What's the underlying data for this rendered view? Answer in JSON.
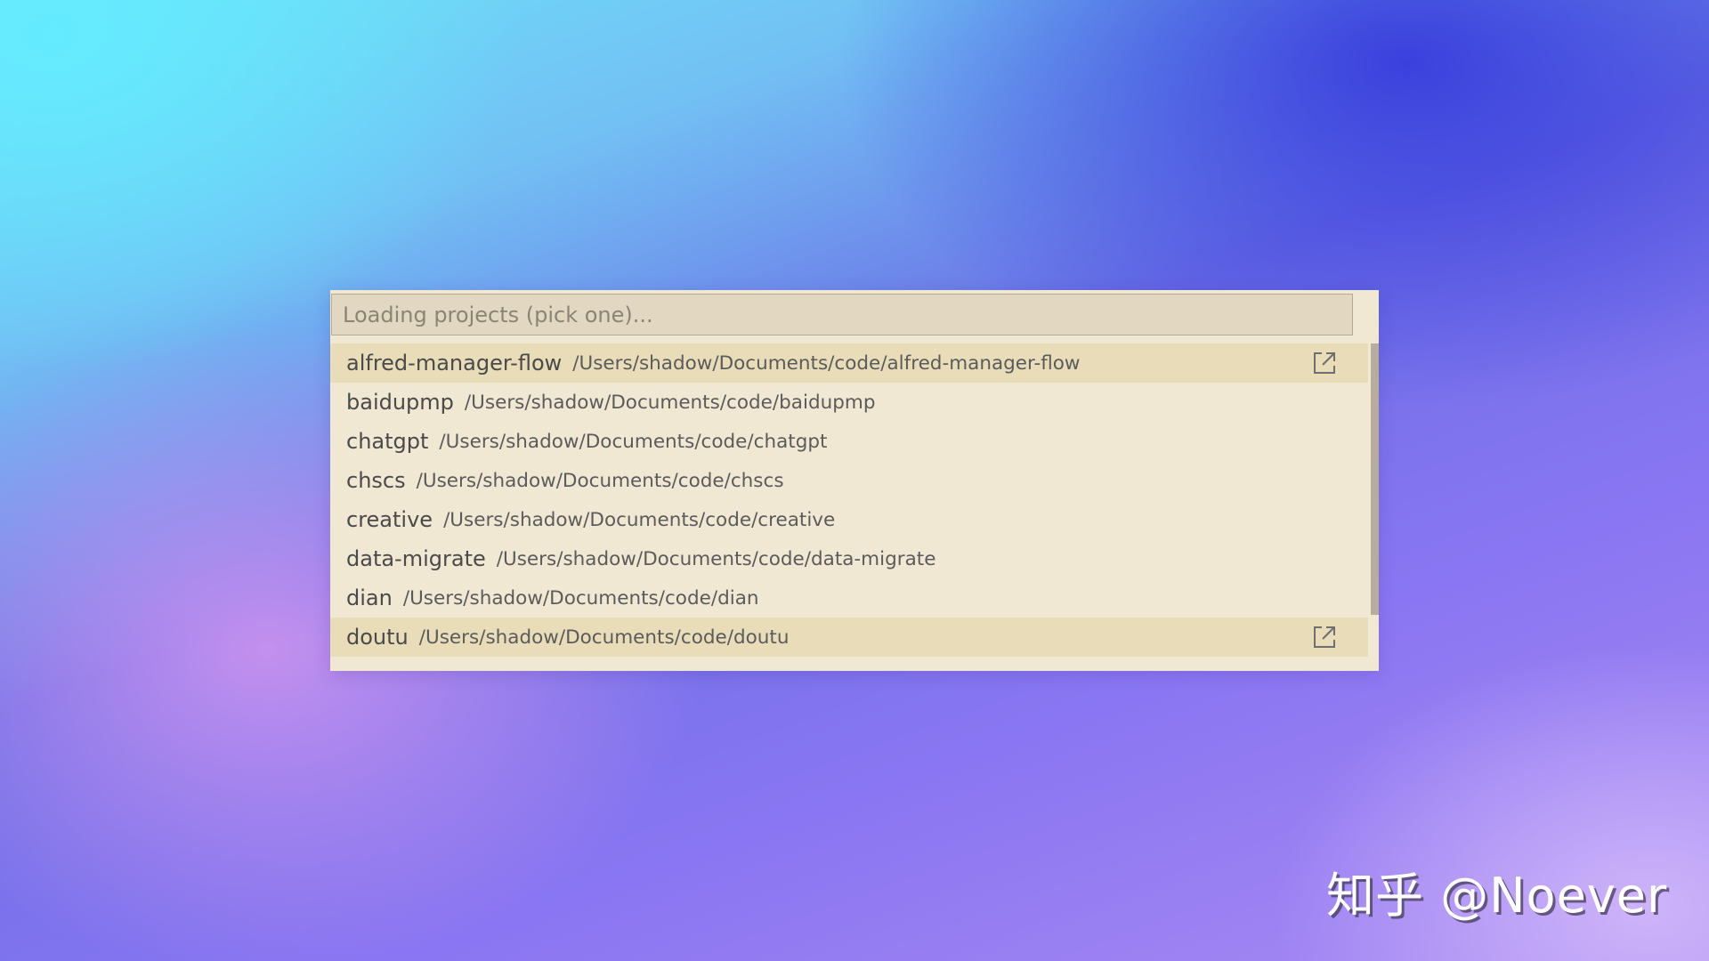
{
  "search": {
    "placeholder": "Loading projects (pick one)..."
  },
  "projects": [
    {
      "name": "alfred-manager-flow",
      "path": "/Users/shadow/Documents/code/alfred-manager-flow",
      "highlighted": true
    },
    {
      "name": "baidupmp",
      "path": "/Users/shadow/Documents/code/baidupmp",
      "highlighted": false
    },
    {
      "name": "chatgpt",
      "path": "/Users/shadow/Documents/code/chatgpt",
      "highlighted": false
    },
    {
      "name": "chscs",
      "path": "/Users/shadow/Documents/code/chscs",
      "highlighted": false
    },
    {
      "name": "creative",
      "path": "/Users/shadow/Documents/code/creative",
      "highlighted": false
    },
    {
      "name": "data-migrate",
      "path": "/Users/shadow/Documents/code/data-migrate",
      "highlighted": false
    },
    {
      "name": "dian",
      "path": "/Users/shadow/Documents/code/dian",
      "highlighted": false
    },
    {
      "name": "doutu",
      "path": "/Users/shadow/Documents/code/doutu",
      "highlighted": true
    }
  ],
  "item_icon": "open-in-new-window-icon",
  "watermark": "知乎 @Noever",
  "colors": {
    "panel_bg": "#f1e8d4",
    "input_bg": "#e2d8c2",
    "highlight_bg": "#e8dcb9",
    "scrollbar_thumb": "#b6ad9c"
  }
}
